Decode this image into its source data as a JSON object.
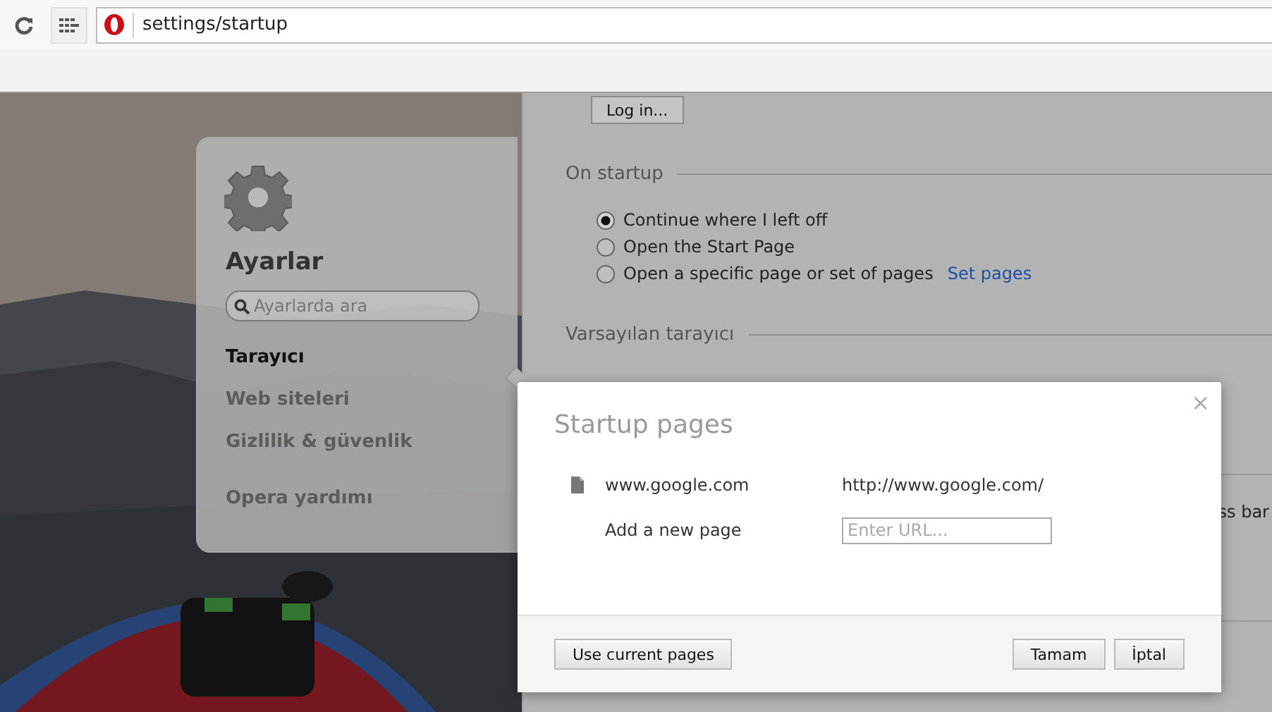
{
  "toolbar": {
    "address": "settings/startup"
  },
  "sidebar": {
    "title": "Ayarlar",
    "search": {
      "placeholder": "Ayarlarda ara"
    },
    "items": [
      {
        "label": "Tarayıcı",
        "selected": true
      },
      {
        "label": "Web siteleri",
        "selected": false
      },
      {
        "label": "Gizlilik & güvenlik",
        "selected": false
      },
      {
        "label": "Opera yardımı",
        "selected": false
      }
    ]
  },
  "settings": {
    "login_button": "Log in...",
    "startup": {
      "heading": "On startup",
      "options": [
        {
          "label": "Continue where I left off",
          "selected": true
        },
        {
          "label": "Open the Start Page",
          "selected": false
        },
        {
          "label": "Open a specific page or set of pages",
          "selected": false,
          "link": "Set pages"
        }
      ]
    },
    "default_browser": {
      "heading": "Varsayılan tarayıcı"
    },
    "cut_text": "ss bar"
  },
  "dialog": {
    "title": "Startup pages",
    "close": "×",
    "pages": [
      {
        "name": "www.google.com",
        "url": "http://www.google.com/"
      }
    ],
    "add": {
      "label": "Add a new page",
      "placeholder": "Enter URL..."
    },
    "buttons": {
      "use_current": "Use current pages",
      "ok": "Tamam",
      "cancel": "İptal"
    }
  }
}
